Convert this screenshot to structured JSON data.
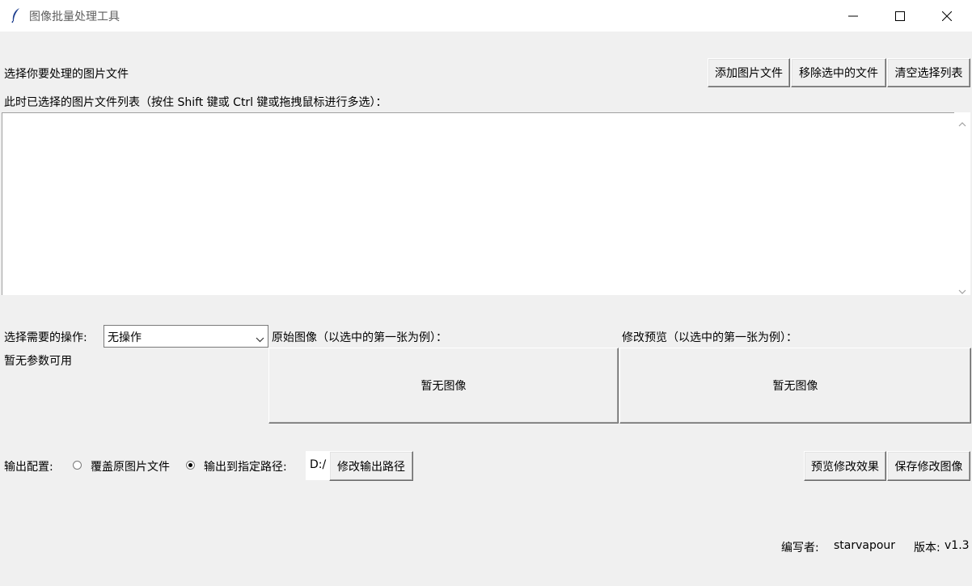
{
  "window": {
    "title": "图像批量处理工具",
    "icon": "feather-icon",
    "controls": [
      "minimize-icon",
      "maximize-icon",
      "close-icon"
    ]
  },
  "files": {
    "select_label": "选择你要处理的图片文件",
    "list_label": "此时已选择的图片文件列表（按住 Shift 键或 Ctrl 键或拖拽鼠标进行多选）：",
    "add_button": "添加图片文件",
    "remove_button": "移除选中的文件",
    "clear_button": "清空选择列表",
    "items": []
  },
  "operation": {
    "label": "选择需要的操作:",
    "selected": "无操作",
    "params_text": "暂无参数可用"
  },
  "preview": {
    "original_label": "原始图像（以选中的第一张为例）：",
    "original_placeholder": "暂无图像",
    "modified_label": "修改预览（以选中的第一张为例）：",
    "modified_placeholder": "暂无图像"
  },
  "output": {
    "label": "输出配置:",
    "option_overwrite": "覆盖原图片文件",
    "option_path": "输出到指定路径:",
    "selected_option": "path",
    "path_value": "D:/",
    "change_path_button": "修改输出路径"
  },
  "actions": {
    "preview_button": "预览修改效果",
    "save_button": "保存修改图像"
  },
  "footer": {
    "author_label": "编写者:",
    "author": "starvapour",
    "version_label": "版本:",
    "version": "v1.3"
  }
}
